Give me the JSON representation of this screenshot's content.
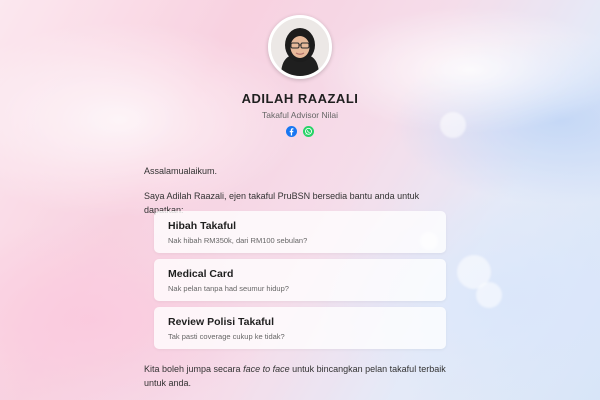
{
  "profile": {
    "name": "ADILAH RAAZALI",
    "title": "Takaful Advisor Nilai",
    "avatar_icon": "person-hijab-avatar",
    "socials": [
      {
        "icon": "facebook-icon",
        "color": "#1877f2"
      },
      {
        "icon": "whatsapp-icon",
        "color": "#25d366"
      }
    ]
  },
  "intro": {
    "greeting": "Assalamualaikum.",
    "description": "Saya Adilah Raazali, ejen takaful PruBSN bersedia bantu anda untuk dapatkan:"
  },
  "services": [
    {
      "title": "Hibah Takaful",
      "desc": "Nak hibah RM350k, dari RM100 sebulan?"
    },
    {
      "title": "Medical Card",
      "desc": "Nak pelan tanpa had seumur hidup?"
    },
    {
      "title": "Review Polisi Takaful",
      "desc": "Tak pasti coverage cukup ke tidak?"
    }
  ],
  "footer": {
    "before": "Kita boleh jumpa secara ",
    "emphasis": "face to face",
    "after": " untuk bincangkan pelan takaful terbaik untuk anda."
  }
}
